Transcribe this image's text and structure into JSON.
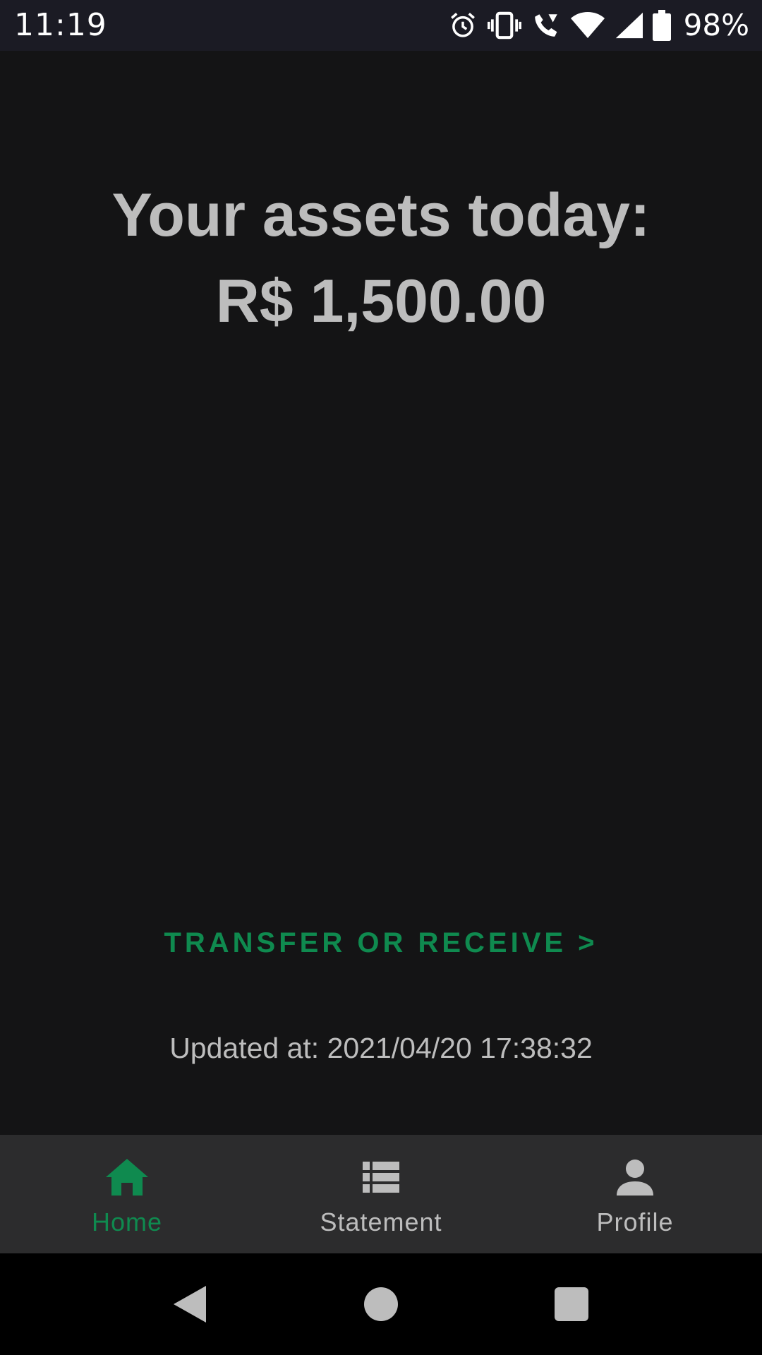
{
  "status_bar": {
    "time": "11:19",
    "battery_percent": "98%",
    "icons": [
      "alarm-icon",
      "vibrate-icon",
      "wifi-calling-icon",
      "wifi-icon",
      "cell-signal-icon",
      "battery-icon"
    ]
  },
  "main": {
    "assets_title": "Your assets today:",
    "assets_value": "R$ 1,500.00",
    "transfer_label": "TRANSFER OR RECEIVE >",
    "updated_at": "Updated at: 2021/04/20 17:38:32"
  },
  "bottom_nav": {
    "items": [
      {
        "label": "Home",
        "icon": "home-icon",
        "active": true
      },
      {
        "label": "Statement",
        "icon": "list-icon",
        "active": false
      },
      {
        "label": "Profile",
        "icon": "person-icon",
        "active": false
      }
    ]
  },
  "system_nav": {
    "icons": [
      "back-icon",
      "home-circle-icon",
      "recents-icon"
    ]
  },
  "colors": {
    "background": "#141415",
    "status_bar": "#1b1b24",
    "bottom_nav": "#2c2c2d",
    "accent_green": "#0f8a4f",
    "text_gray": "#bdbdbd"
  }
}
